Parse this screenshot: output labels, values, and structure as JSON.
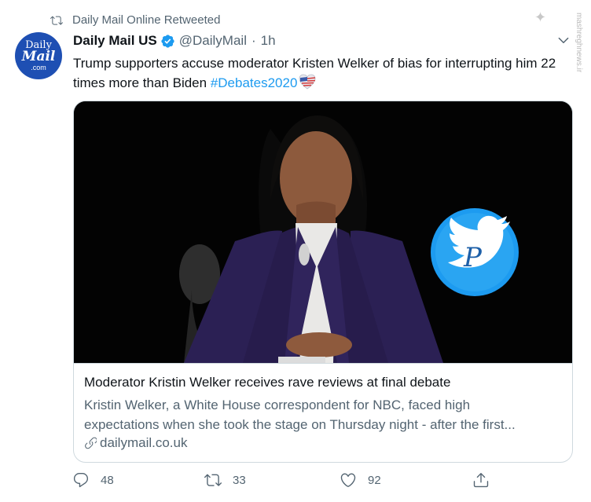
{
  "retweet": {
    "label": "Daily Mail Online Retweeted",
    "icon": "retweet-icon"
  },
  "author": {
    "avatar_lines": [
      "Daily",
      "Mail",
      ".com"
    ],
    "display_name": "Daily Mail US",
    "verified_icon": "verified-badge-icon",
    "handle": "@DailyMail",
    "separator": "·",
    "time": "1h"
  },
  "tweet": {
    "text": "Trump supporters accuse moderator Kristen Welker of bias for interrupting him 22 times more than Biden ",
    "hashtag": "#Debates2020",
    "hashtag_emoji": "us-flag-heart-emoji"
  },
  "card": {
    "title": "Moderator Kristin Welker receives rave reviews at final debate",
    "description_lines": [
      "Kristin Welker, a White House correspondent for NBC, faced high",
      "expectations when she took the stage on Thursday night - after the first..."
    ],
    "domain": "dailymail.co.uk",
    "link_icon": "link-icon"
  },
  "actions": {
    "reply": {
      "icon": "reply-icon",
      "count": "48"
    },
    "retweet": {
      "icon": "retweet-icon",
      "count": "33"
    },
    "like": {
      "icon": "heart-icon",
      "count": "92"
    },
    "share": {
      "icon": "share-icon"
    }
  },
  "watermark": {
    "url": "mashreghnews.ir"
  },
  "colors": {
    "accent": "#1d9bf0",
    "text_primary": "#0f1419",
    "text_secondary": "#536471",
    "border": "#cfd9de",
    "avatar_bg": "#1e4fb3"
  }
}
